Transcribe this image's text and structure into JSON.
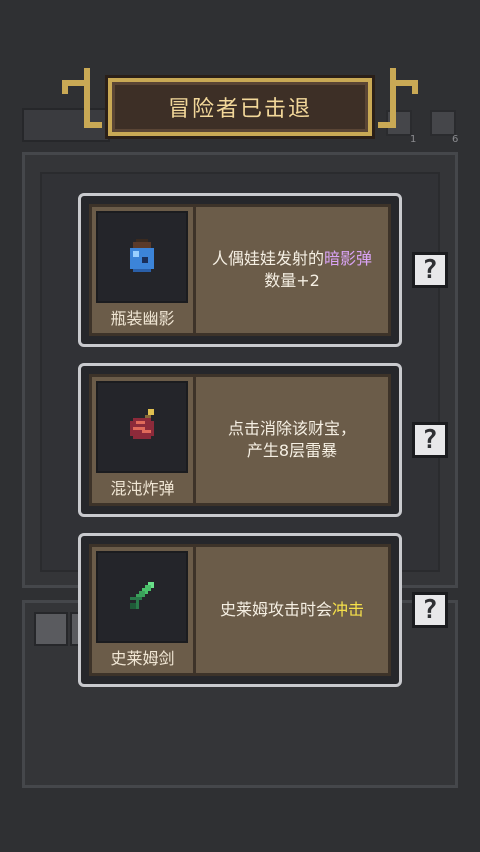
{
  "banner": {
    "title": "冒险者已击退"
  },
  "side_counters": [
    {
      "icon": "chest-icon",
      "count": "1"
    },
    {
      "icon": "pawn-icon",
      "count": "6"
    }
  ],
  "cards": [
    {
      "item_name": "瓶装幽影",
      "item_icon": "bottled-shadow-icon",
      "desc_parts": [
        "人偶娃娃发射的",
        "暗影弹",
        "数量+2"
      ],
      "highlight_color": "#d9a3f5"
    },
    {
      "item_name": "混沌炸弹",
      "item_icon": "chaos-bomb-icon",
      "desc_line1": "点击消除该财宝，",
      "desc_line2": "产生8层雷暴"
    },
    {
      "item_name": "史莱姆剑",
      "item_icon": "slime-sword-icon",
      "desc_parts": [
        "史莱姆攻击时会",
        "冲击",
        ""
      ],
      "highlight_color": "#f5e04a"
    }
  ],
  "help_label": "?"
}
